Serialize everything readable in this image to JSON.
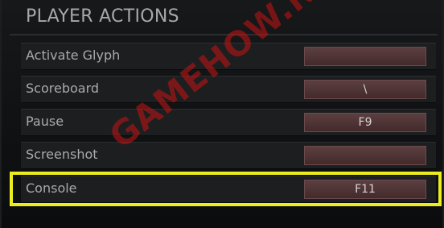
{
  "section": {
    "title": "PLAYER ACTIONS"
  },
  "rows": [
    {
      "label": "Activate Glyph",
      "key": ""
    },
    {
      "label": "Scoreboard",
      "key": "\\"
    },
    {
      "label": "Pause",
      "key": "F9"
    },
    {
      "label": "Screenshot",
      "key": ""
    },
    {
      "label": "Console",
      "key": "F11"
    }
  ],
  "highlight": {
    "row_label": "Console",
    "color": "#ecec1e"
  },
  "watermark": {
    "text": "GAMEHOW.NET"
  },
  "colors": {
    "background": "#0c0d0e",
    "row": "#1c1e20",
    "key_button": "#4f3436",
    "text": "#a9aaab"
  }
}
